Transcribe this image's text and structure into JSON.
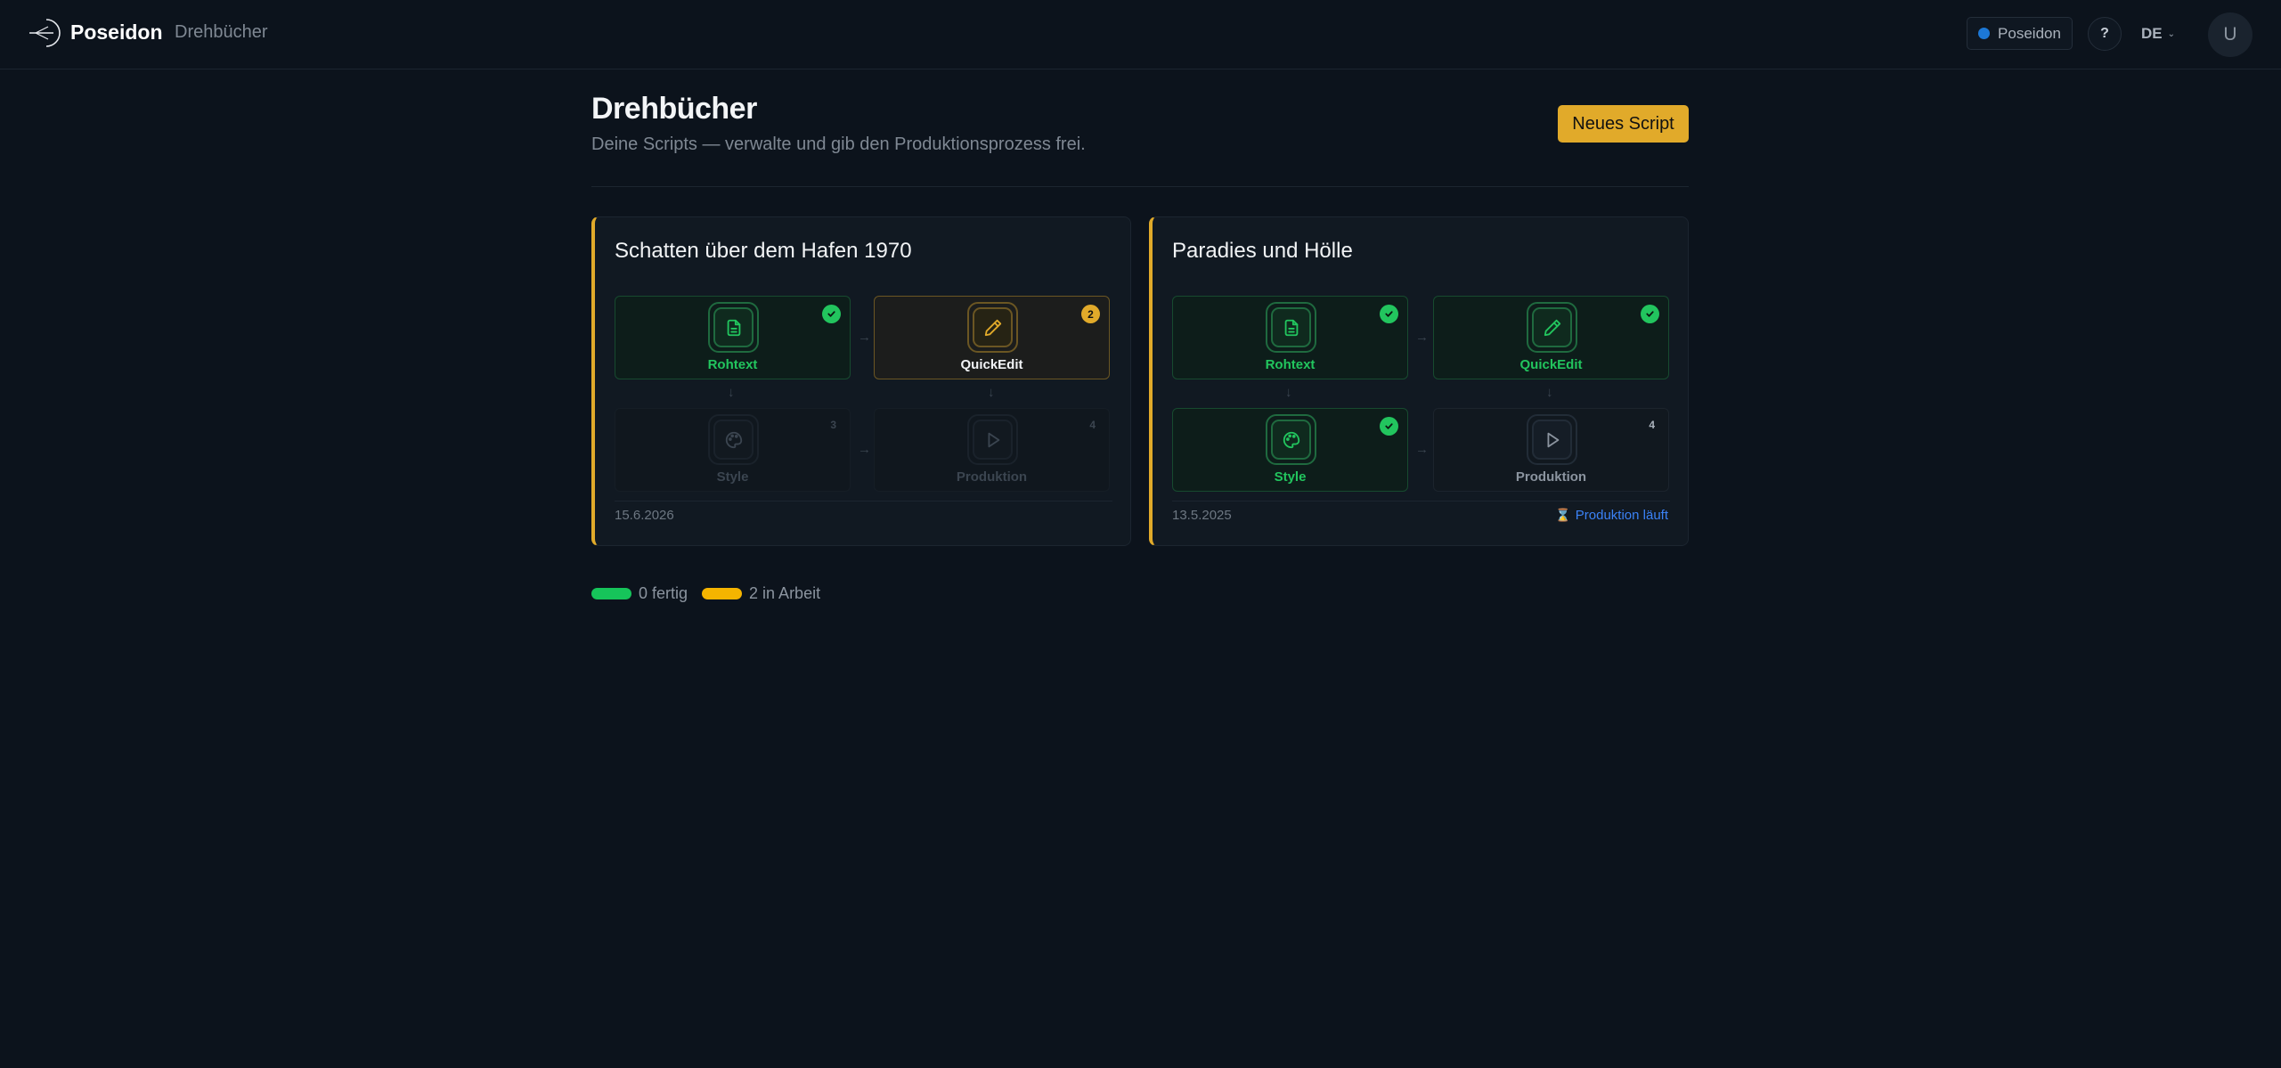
{
  "header": {
    "brand": "Poseidon",
    "breadcrumb": "Drehbücher",
    "workspace": "Poseidon",
    "help": "?",
    "language": "DE",
    "avatar_initial": "U"
  },
  "page": {
    "title": "Drehbücher",
    "subtitle": "Deine Scripts — verwalte und gib den Produktionsprozess frei.",
    "new_button": "Neues Script"
  },
  "cards": [
    {
      "title": "Schatten über dem Hafen 1970",
      "steps": [
        {
          "label": "Rohtext",
          "state": "done",
          "icon": "document-icon"
        },
        {
          "label": "QuickEdit",
          "state": "active",
          "icon": "pencil-icon",
          "number": "2"
        },
        {
          "label": "Style",
          "state": "locked",
          "icon": "palette-icon",
          "number": "3"
        },
        {
          "label": "Produktion",
          "state": "locked",
          "icon": "play-icon",
          "number": "4"
        }
      ],
      "date": "15.6.2026",
      "status": ""
    },
    {
      "title": "Paradies und Hölle",
      "steps": [
        {
          "label": "Rohtext",
          "state": "done",
          "icon": "document-icon"
        },
        {
          "label": "QuickEdit",
          "state": "done",
          "icon": "pencil-icon"
        },
        {
          "label": "Style",
          "state": "done",
          "icon": "palette-icon"
        },
        {
          "label": "Produktion",
          "state": "idle",
          "icon": "play-icon",
          "number": "4"
        }
      ],
      "date": "13.5.2025",
      "status": "Produktion läuft"
    }
  ],
  "legend": {
    "done": "0 fertig",
    "in_progress": "2 in Arbeit"
  },
  "colors": {
    "accent": "#e1aa2a",
    "done": "#22c55e",
    "legend_done": "#16c45a",
    "legend_progress": "#f5b400",
    "status_link": "#3b82f6"
  }
}
